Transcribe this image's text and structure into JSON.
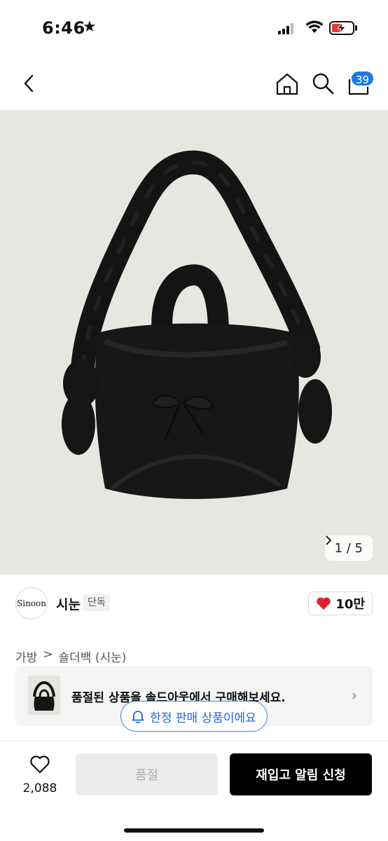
{
  "status_bar": {
    "time": "6:46",
    "star": "★",
    "icons": [
      "signal-icon",
      "wifi-icon",
      "battery-charging-icon"
    ]
  },
  "nav": {
    "back_icon": "chevron-left-icon",
    "home_icon": "home-icon",
    "search_icon": "search-icon",
    "cart_icon": "cart-icon",
    "cart_count": "39",
    "badge_color": "#1e78e6"
  },
  "hero": {
    "page_indicator": "1 / 5",
    "background": "#e8e6e1"
  },
  "brand": {
    "logo_text": "Sinoon",
    "name": "시눈",
    "tag": "단독",
    "likes": "10만",
    "heart_color": "#e0202e"
  },
  "breadcrumb": {
    "category": "가방",
    "separator": ">",
    "subcategory": "숄더백 (시눈)"
  },
  "soldout_banner": {
    "text": "품절된 상품을 솔드아웃에서 구매해보세요.",
    "chevron": "›"
  },
  "limited_chip": {
    "icon": "bell-icon",
    "text": "한정 판매 상품이에요",
    "color": "#1e66e6"
  },
  "bottom_bar": {
    "wish_icon": "heart-outline-icon",
    "wish_count": "2,088",
    "soldout_label": "품절",
    "restock_label": "재입고 알림 신청"
  }
}
